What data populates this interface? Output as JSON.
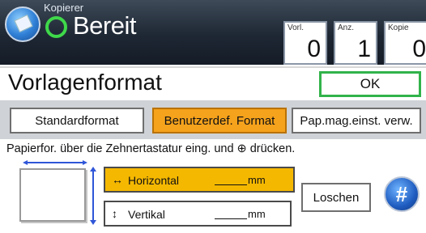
{
  "header": {
    "app_name": "Kopierer",
    "status": "Bereit",
    "counters": [
      {
        "label": "Vorl.",
        "value": "0"
      },
      {
        "label": "Anz.",
        "value": "1"
      },
      {
        "label": "Kopie",
        "value": "0"
      }
    ]
  },
  "title": "Vorlagenformat",
  "ok_label": "OK",
  "tabs": [
    {
      "label": "Standardformat",
      "active": false
    },
    {
      "label": "Benutzerdef. Format",
      "active": true
    },
    {
      "label": "Pap.mag.einst. verw.",
      "active": false
    }
  ],
  "instruction": "Papierfor. über die Zehnertastatur eing. und ⊕ drücken.",
  "fields": {
    "horizontal": {
      "glyph": "↔",
      "label": "Horizontal",
      "value": "",
      "unit": "mm",
      "selected": true
    },
    "vertical": {
      "glyph": "↕",
      "label": "Vertikal",
      "value": "",
      "unit": "mm",
      "selected": false
    }
  },
  "clear_label": "Loschen",
  "hash_label": "#",
  "colors": {
    "accent": "#f5a21c",
    "ok_border": "#31b34a",
    "status_ring": "#3fd84a",
    "header_bg": "#1e2734"
  }
}
